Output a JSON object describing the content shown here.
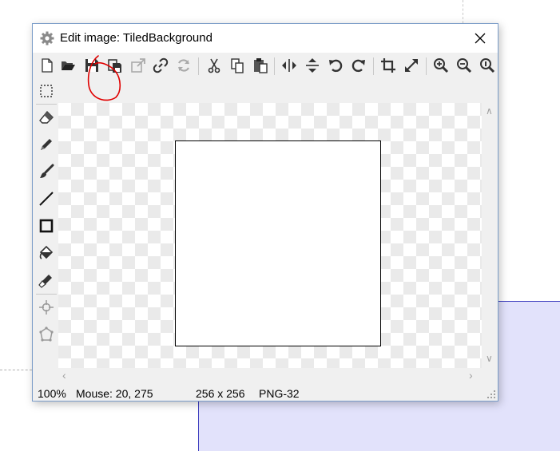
{
  "window": {
    "title": "Edit image: TiledBackground",
    "close_icon": "close-icon"
  },
  "toolbar": {
    "items": [
      "new-icon",
      "open-icon",
      "save-icon",
      "save-as-icon",
      "export-icon",
      "link-icon",
      "refresh-icon",
      "cut-icon",
      "copy-icon",
      "paste-icon",
      "flip-horizontal-icon",
      "flip-vertical-icon",
      "rotate-left-icon",
      "rotate-right-icon",
      "crop-icon",
      "resize-icon",
      "zoom-in-icon",
      "zoom-out-icon",
      "zoom-actual-icon"
    ],
    "annotation_color": "#e00000"
  },
  "tools": [
    "select-icon",
    "eraser-icon",
    "pencil-icon",
    "brush-icon",
    "line-icon",
    "rectangle-icon",
    "fill-icon",
    "eyedropper-icon",
    "origin-icon",
    "collision-mask-icon"
  ],
  "status": {
    "zoom": "100%",
    "mouse": "Mouse: 20, 275",
    "size": "256 x 256",
    "format": "PNG-32"
  },
  "colors": {
    "window_border": "#7a9cc8",
    "panel_fill": "#e2e2fb",
    "panel_border": "#4040c0"
  }
}
